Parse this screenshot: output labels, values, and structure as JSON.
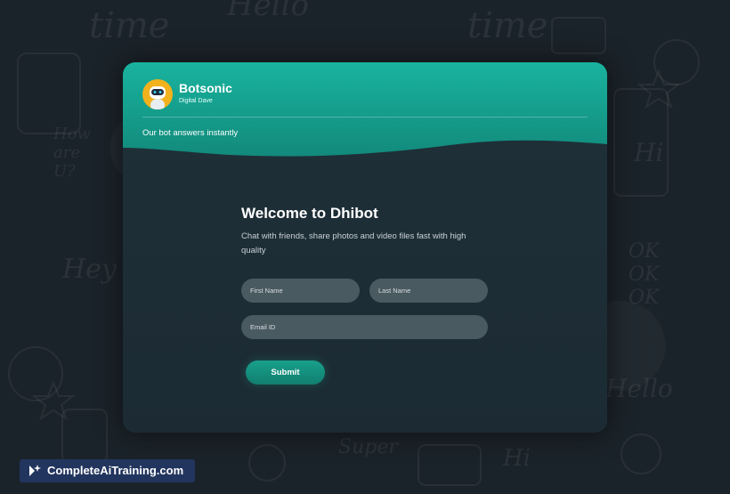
{
  "colors": {
    "accent": "#17a593",
    "background": "#1b232a",
    "card": "#1f3039",
    "input": "#4a5a61"
  },
  "background": {
    "doodles": [
      "Hello",
      "time",
      "time",
      "How are U?",
      "Hey",
      "Hi",
      "OK OK OK",
      "Hello",
      "Super",
      "Hi"
    ]
  },
  "header": {
    "bot_name": "Botsonic",
    "bot_subtitle": "Digital Dave",
    "tagline": "Our bot answers instantly"
  },
  "form": {
    "title": "Welcome to Dhibot",
    "description": "Chat with friends, share photos and video files fast with high quality",
    "first_name_placeholder": "First Name",
    "last_name_placeholder": "Last Name",
    "email_placeholder": "Email ID",
    "submit_label": "Submit"
  },
  "watermark": {
    "text": "CompleteAiTraining.com"
  }
}
